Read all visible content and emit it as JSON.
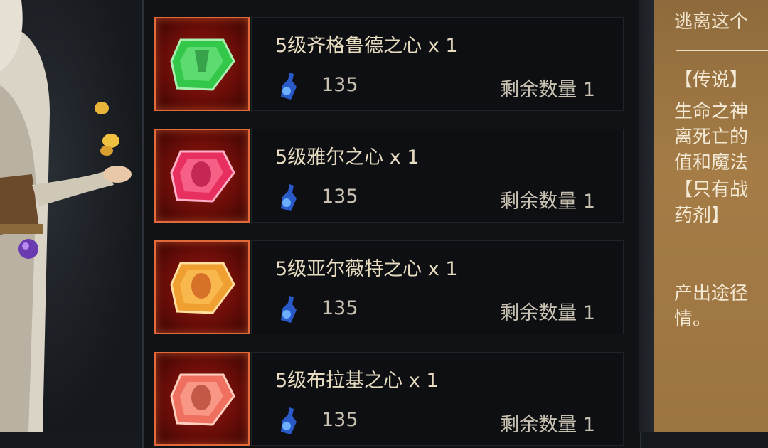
{
  "items": [
    {
      "name": "5级齐格鲁德之心 x 1",
      "price": "135",
      "stock": "剩余数量 1",
      "gem_color": "#33c84a",
      "gem_icon": "green-gem-icon"
    },
    {
      "name": "5级雅尔之心 x 1",
      "price": "135",
      "stock": "剩余数量 1",
      "gem_color": "#e83060",
      "gem_icon": "pink-gem-icon"
    },
    {
      "name": "5级亚尔薇特之心 x 1",
      "price": "135",
      "stock": "剩余数量 1",
      "gem_color": "#f0a030",
      "gem_icon": "orange-gem-icon"
    },
    {
      "name": "5级布拉基之心 x 1",
      "price": "135",
      "stock": "剩余数量 1",
      "gem_color": "#f07060",
      "gem_icon": "coral-gem-icon"
    }
  ],
  "currency_icon": "potion-bottle-icon",
  "description": {
    "top_line": "逃离这个",
    "lines": [
      "【传说】",
      "生命之神",
      "离死亡的",
      "值和魔法",
      "【只有战",
      "药剂】"
    ],
    "source_line1": "产出途径",
    "source_line2": "情。"
  },
  "colors": {
    "frame_border": "#e06a3a",
    "name_text": "#e8dcc0",
    "desc_panel": "#a57c46"
  }
}
